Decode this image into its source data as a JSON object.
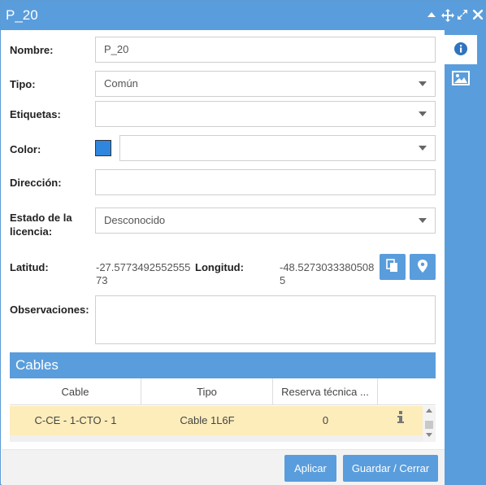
{
  "window": {
    "title": "P_20",
    "controls": [
      "collapse-icon",
      "move-icon",
      "expand-icon",
      "close-icon"
    ]
  },
  "sidebar": {
    "tabs": [
      {
        "icon": "info-icon",
        "active": true
      },
      {
        "icon": "image-icon",
        "active": false
      }
    ]
  },
  "form": {
    "nombre_label": "Nombre:",
    "nombre_value": "P_20",
    "tipo_label": "Tipo:",
    "tipo_value": "Común",
    "etiquetas_label": "Etiquetas:",
    "etiquetas_value": "",
    "color_label": "Color:",
    "color_swatch": "#2e86de",
    "color_value": "",
    "direccion_label": "Dirección:",
    "direccion_value": "",
    "estado_label_line1": "Estado de la",
    "estado_label_line2": "licencia:",
    "estado_value": "Desconocido",
    "latitud_label": "Latitud:",
    "latitud_line1": "-27.5773492552555",
    "latitud_line2": "73",
    "longitud_label": "Longitud:",
    "longitud_line1": "-48.5273033380508",
    "longitud_line2": "5",
    "observaciones_label": "Observaciones:",
    "observaciones_value": ""
  },
  "cables": {
    "header": "Cables",
    "columns": [
      "Cable",
      "Tipo",
      "Reserva técnica ...",
      ""
    ],
    "rows": [
      {
        "cable": "C-CE - 1-CTO - 1",
        "tipo": "Cable 1L6F",
        "reserva": "0",
        "icon": "info-icon"
      }
    ]
  },
  "footer": {
    "apply_label": "Aplicar",
    "save_close_label": "Guardar / Cerrar"
  },
  "colors": {
    "accent": "#5a9ddc",
    "row_highlight": "#fdedbb"
  }
}
